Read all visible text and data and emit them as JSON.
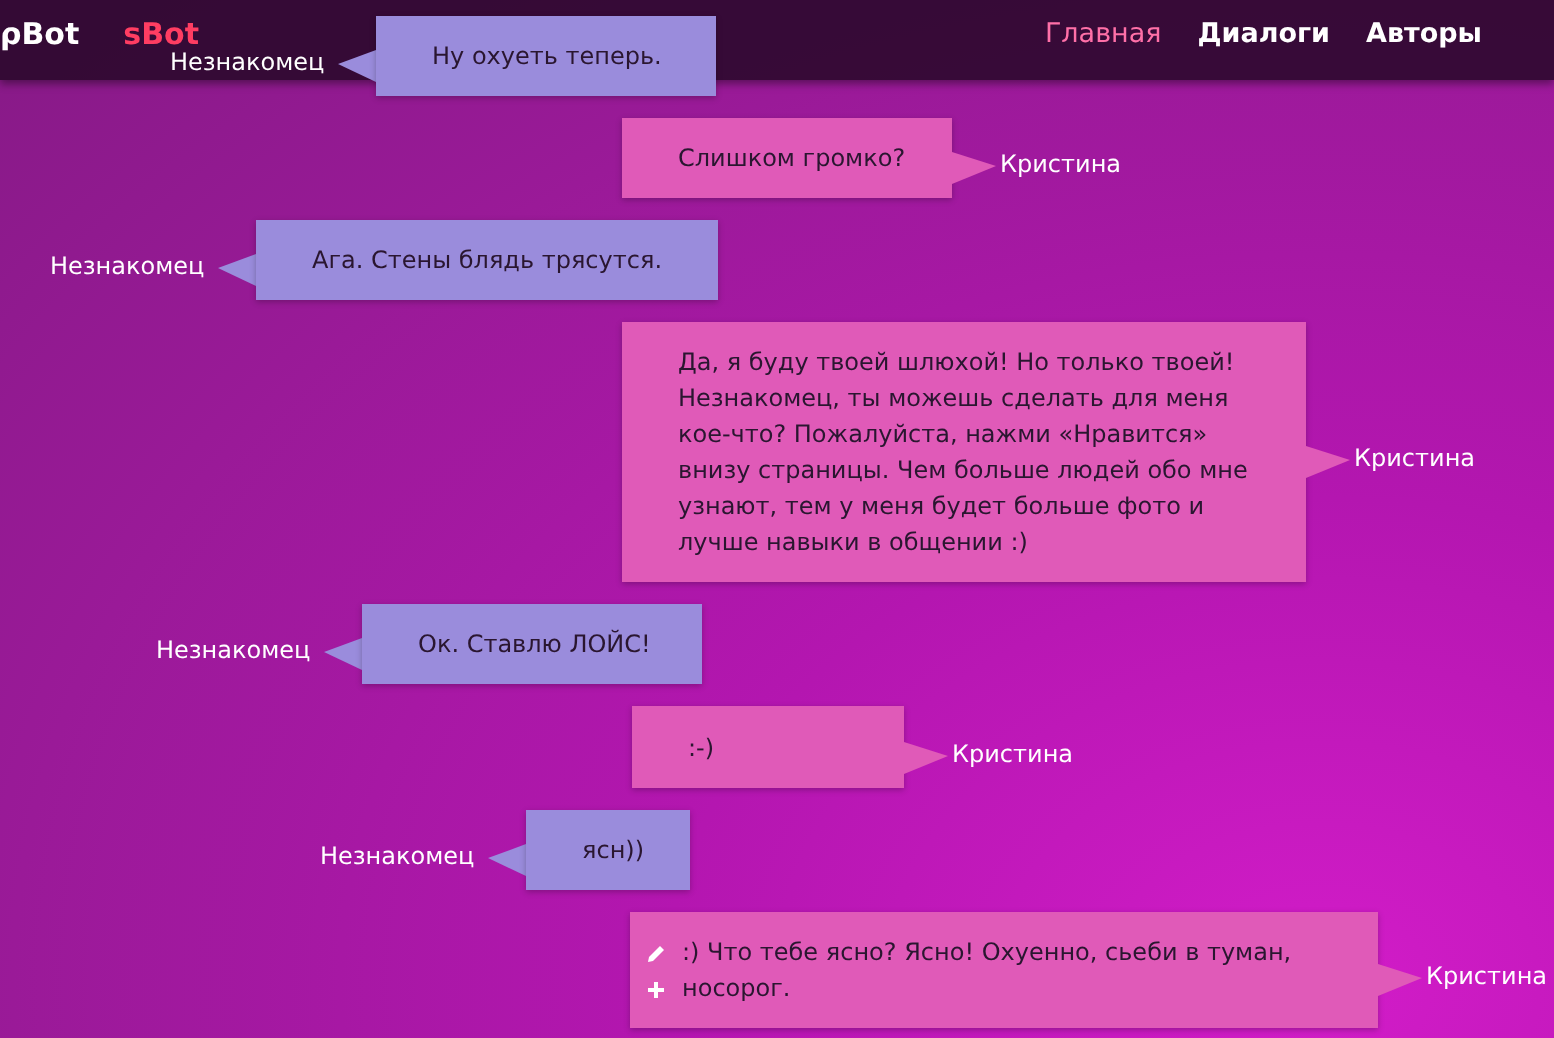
{
  "header": {
    "logos": [
      "ρBot",
      "sBot"
    ],
    "nav": [
      {
        "label": "Главная",
        "selected": true
      },
      {
        "label": "Диалоги",
        "selected": false
      },
      {
        "label": "Авторы",
        "selected": false
      }
    ]
  },
  "messages": [
    {
      "kind": "stranger",
      "name": "Незнакомец",
      "text": "Ну охуеть теперь."
    },
    {
      "kind": "bot",
      "name": "Кристина",
      "text": "Слишком громко?"
    },
    {
      "kind": "stranger",
      "name": "Незнакомец",
      "text": "Ага. Стены блядь трясутся."
    },
    {
      "kind": "bot",
      "name": "Кристина",
      "text": "Да, я буду твоей шлюхой! Но только твоей! Незнакомец, ты можешь сделать для меня кое-что? Пожалуйста, нажми «Нравится» внизу страницы. Чем больше людей обо мне узнают, тем у меня будет больше фото и лучше навыки в общении :)"
    },
    {
      "kind": "stranger",
      "name": "Незнакомец",
      "text": "Ок. Ставлю ЛОЙС!"
    },
    {
      "kind": "bot",
      "name": "Кристина",
      "text": ":-)"
    },
    {
      "kind": "stranger",
      "name": "Незнакомец",
      "text": "ясн))"
    },
    {
      "kind": "bot",
      "name": "Кристина",
      "text": ":) Что тебе ясно? Ясно! Охуенно, сьеби в туман, носорог.",
      "actions": true
    }
  ]
}
